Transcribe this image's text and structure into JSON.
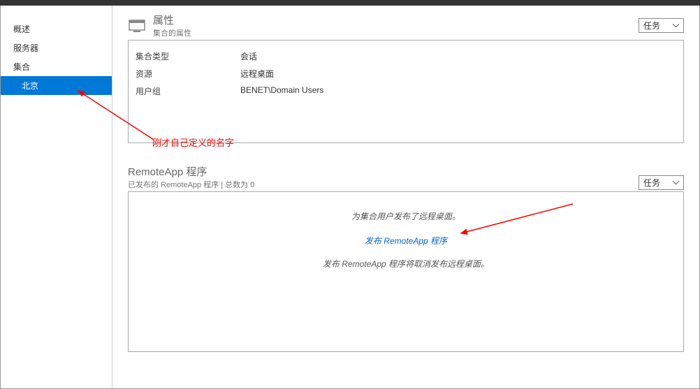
{
  "sidebar": {
    "items": [
      {
        "label": "概述"
      },
      {
        "label": "服务器"
      },
      {
        "label": "集合"
      },
      {
        "label": "北京"
      }
    ]
  },
  "properties_panel": {
    "title": "属性",
    "subtitle": "集合的属性",
    "tasks_label": "任务",
    "rows": [
      {
        "label": "集合类型",
        "value": "会话"
      },
      {
        "label": "资源",
        "value": "远程桌面"
      },
      {
        "label": "用户组",
        "value": "BENET\\Domain Users"
      }
    ]
  },
  "remoteapp_panel": {
    "title": "RemoteApp 程序",
    "subtitle": "已发布的 RemoteApp 程序 | 总数为 0",
    "tasks_label": "任务",
    "message1": "为集合用户发布了远程桌面。",
    "publish_link": "发布 RemoteApp 程序",
    "message2": "发布 RemoteApp 程序将取消发布远程桌面。"
  },
  "annotations": {
    "note1": "刚才自己定义的名字"
  }
}
